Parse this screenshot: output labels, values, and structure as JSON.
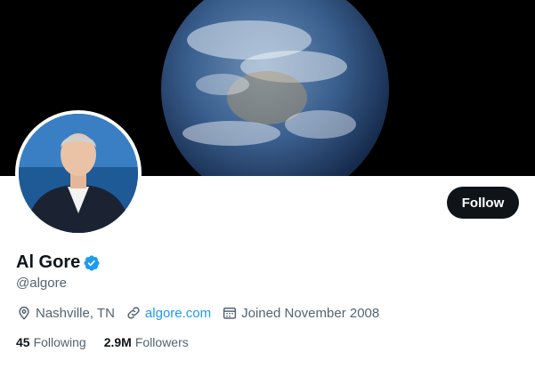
{
  "profile": {
    "display_name": "Al Gore",
    "handle": "@algore",
    "follow_label": "Follow",
    "location": "Nashville, TN",
    "website": "algore.com",
    "joined": "Joined November 2008",
    "following_count": "45",
    "following_label": "Following",
    "followers_count": "2.9M",
    "followers_label": "Followers"
  },
  "icons": {
    "verified": "verified-badge-icon",
    "location": "map-pin-icon",
    "link": "link-icon",
    "calendar": "calendar-icon"
  },
  "colors": {
    "accent": "#1d9bf0",
    "text_primary": "#0f1419",
    "text_secondary": "#536471",
    "button_bg": "#0f1419",
    "banner_bg": "#000000"
  }
}
